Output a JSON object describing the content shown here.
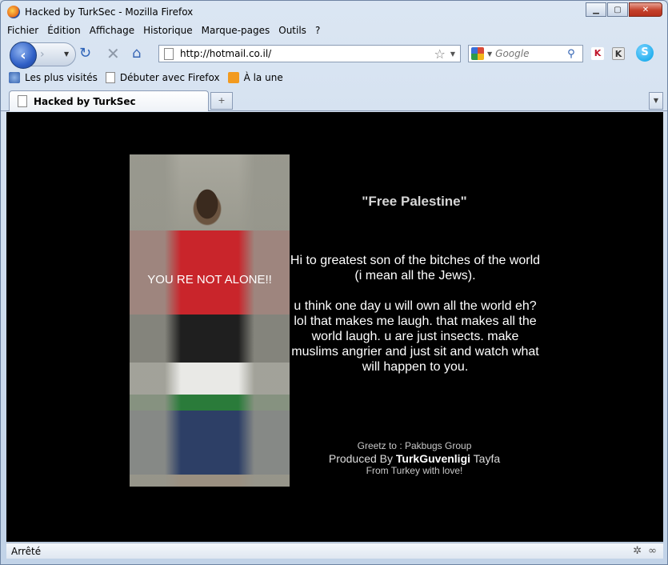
{
  "window": {
    "title": "Hacked by TurkSec - Mozilla Firefox"
  },
  "menu": [
    "Fichier",
    "Édition",
    "Affichage",
    "Historique",
    "Marque-pages",
    "Outils",
    "?"
  ],
  "nav": {
    "url": "http://hotmail.co.il/",
    "search_placeholder": "Google"
  },
  "bookmarks": [
    "Les plus visités",
    "Débuter avec Firefox",
    "À la une"
  ],
  "tab": {
    "title": "Hacked by TurkSec"
  },
  "content": {
    "photo_caption": "YOU RE NOT ALONE!!",
    "heading": "\"Free Palestine\"",
    "para1": "Hi to greatest son of the bitches of the world (i mean all the Jews).",
    "para2": "u think one day u will own all the world eh? lol that makes me laugh. that makes all the world laugh. u are just insects. make muslims angrier and just sit and watch what will happen to you.",
    "greetz": "Greetz to : Pakbugs Group",
    "produced_prefix": "Produced By",
    "produced_name": "TurkGuvenligi",
    "produced_suffix": "Tayfa",
    "from": "From Turkey with love!"
  },
  "status": {
    "text": "Arrêté"
  },
  "icons": {
    "back": "back-arrow-icon",
    "forward": "forward-arrow-icon",
    "reload": "reload-icon",
    "stop": "stop-icon",
    "home": "home-icon",
    "star": "star-icon",
    "search": "magnifier-icon"
  }
}
